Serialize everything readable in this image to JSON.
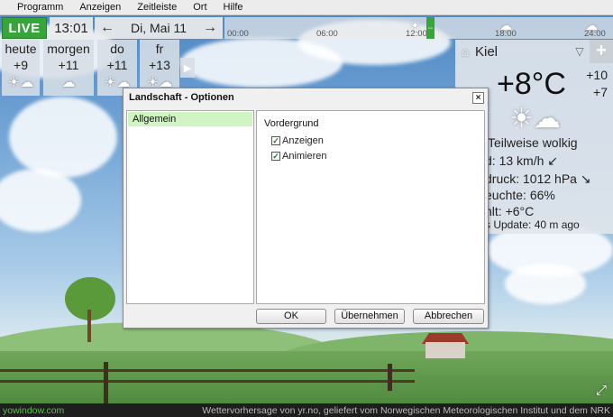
{
  "menu": [
    "Programm",
    "Anzeigen",
    "Zeitleiste",
    "Ort",
    "Hilfe"
  ],
  "live_label": "LIVE",
  "time": "13:01",
  "date_nav": {
    "prev": "←",
    "date": "Di, Mai 11",
    "next": "→"
  },
  "timeline": {
    "ticks": [
      "00:00",
      "06:00",
      "12:00",
      "18:00",
      "24:00"
    ],
    "now_marker": "⇔"
  },
  "forecast": [
    {
      "day": "heute",
      "temp": "+9",
      "icon": "sun-cloud-icon"
    },
    {
      "day": "morgen",
      "temp": "+11",
      "icon": "cloud-icon"
    },
    {
      "day": "do",
      "temp": "+11",
      "icon": "sun-cloud-icon"
    },
    {
      "day": "fr",
      "temp": "+13",
      "icon": "sun-cloud-icon"
    }
  ],
  "forecast_more": "▶",
  "current": {
    "city": "Kiel",
    "add": "+",
    "temp": "+8°C",
    "high": "+10",
    "low": "+7",
    "condition": "Teilweise wolkig",
    "wind": "d:  13 km/h  ↙",
    "pressure": "druck:  1012 hPa  ↘",
    "humidity": "euchte:  66%",
    "feels": "hlt:  +6°C",
    "update": "s Update:  40 m ago"
  },
  "dialog": {
    "title": "Landschaft - Optionen",
    "close": "×",
    "categories": [
      "Allgemein"
    ],
    "group": "Vordergrund",
    "options": [
      {
        "label": "Anzeigen",
        "checked": true
      },
      {
        "label": "Animieren",
        "checked": true
      }
    ],
    "buttons": {
      "ok": "OK",
      "apply": "Übernehmen",
      "cancel": "Abbrechen"
    }
  },
  "bottom": {
    "brand": "yowindow.com",
    "credit": "Wettervorhersage von yr.no, geliefert vom Norwegischen Meteorologischen Institut und dem NRK"
  },
  "colors": {
    "live": "#36a63a",
    "selected_category": "#d0f4c4",
    "brand": "#5fbf4c"
  }
}
